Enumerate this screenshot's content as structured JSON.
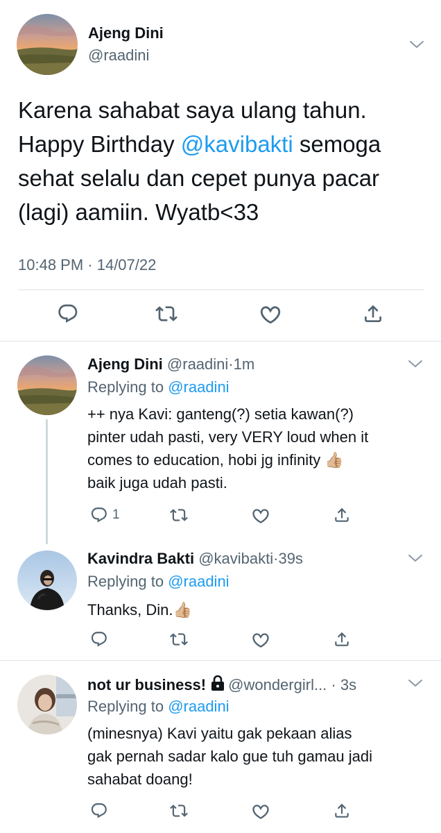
{
  "main_tweet": {
    "author_name": "Ajeng Dini",
    "author_handle": "@raadini",
    "text_lines": [
      [
        "Karena sahabat saya ulang tahun.",
        "",
        ""
      ],
      [
        "Happy Birthday ",
        "@kavibakti",
        " semoga"
      ],
      [
        "sehat selalu dan cepet punya pacar",
        "",
        ""
      ],
      [
        "(lagi) aamiin. Wyatb<33",
        "",
        ""
      ]
    ],
    "timestamp": "10:48 PM · 14/07/22",
    "actions": [
      "reply-icon",
      "retweet-icon",
      "like-icon",
      "share-icon"
    ]
  },
  "replies": [
    {
      "name": "Ajeng Dini",
      "handle": "@raadini",
      "time": "1m",
      "replying_label": "Replying to ",
      "replying_to": "@raadini",
      "text_lines": [
        "++ nya Kavi: ganteng(?) setia kawan(?)",
        "pinter udah pasti, very VERY loud when it",
        "comes to education, hobi jg infinity 👍🏼",
        "baik juga udah pasti."
      ],
      "reply_count": "1"
    },
    {
      "name": "Kavindra Bakti",
      "handle": "@kavibakti",
      "time": "39s",
      "replying_label": "Replying to ",
      "replying_to": "@raadini",
      "text_lines": [
        "Thanks, Din.👍🏼"
      ],
      "reply_count": ""
    },
    {
      "name": "not ur business!",
      "handle": "@wondergirl...",
      "time": "3s",
      "protected": true,
      "replying_label": "Replying to ",
      "replying_to": "@raadini",
      "text_lines": [
        "(minesnya) Kavi yaitu gak pekaan alias",
        "gak pernah sadar kalo gue tuh gamau jadi",
        "sahabat doang!"
      ],
      "reply_count": ""
    }
  ],
  "colors": {
    "accent": "#1d9bf0",
    "secondary_text": "#536471",
    "divider": "#dfe3e7"
  }
}
